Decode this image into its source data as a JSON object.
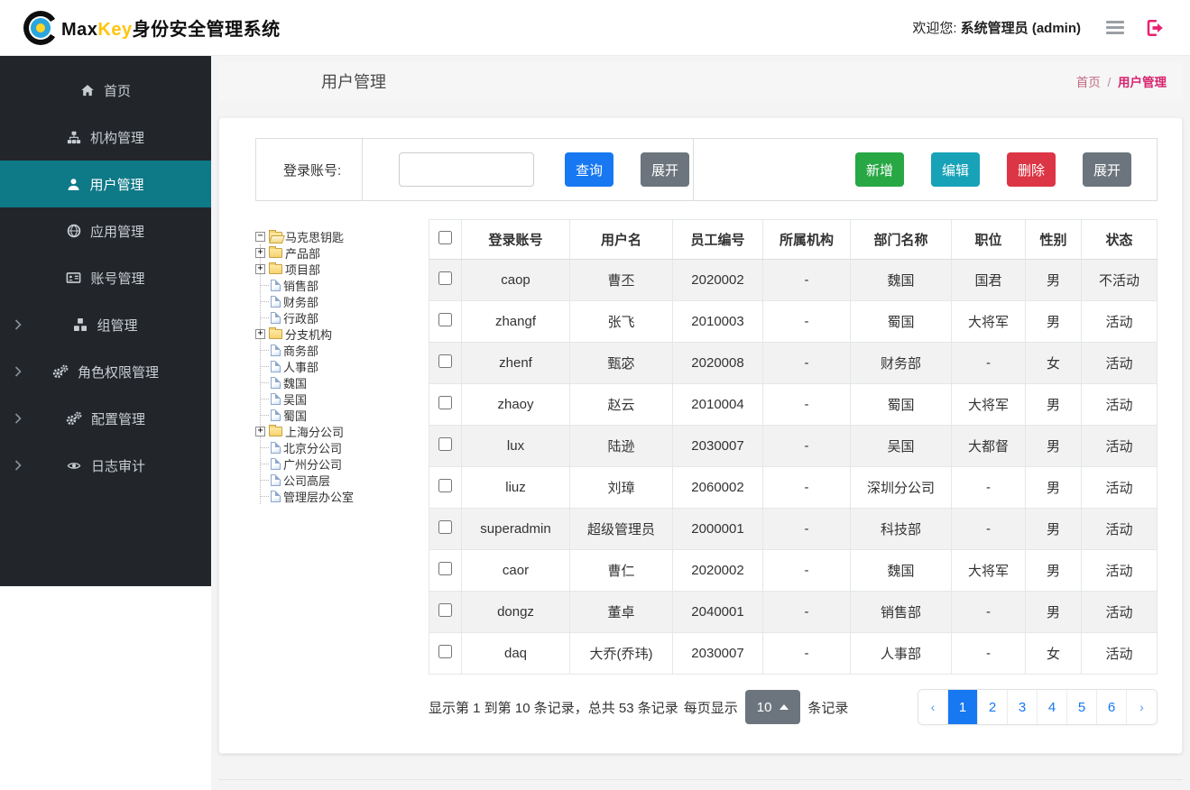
{
  "colors": {
    "accent_blue": "#1778f2",
    "green": "#28a745",
    "teal": "#17a2b8",
    "red": "#dc3545",
    "gray": "#6c757d",
    "sidebar_bg": "#22262b",
    "sidebar_active_teal": "#0e7987",
    "brand_yellow": "#ffc50a",
    "breadcrumb_pink": "#d6246e",
    "logout_pink": "#e8216f"
  },
  "header": {
    "brand_max": "Max",
    "brand_key": "Key",
    "brand_suffix": "身份安全管理系统",
    "welcome_prefix": "欢迎您:",
    "welcome_user": "系统管理员 (admin)",
    "icons": [
      "menu-icon",
      "logout-icon"
    ]
  },
  "sidebar": {
    "items": [
      {
        "key": "home",
        "label": "首页",
        "icon": "home-icon",
        "active": false,
        "has_children": false
      },
      {
        "key": "org-mgmt",
        "label": "机构管理",
        "icon": "sitemap-icon",
        "active": false,
        "has_children": false
      },
      {
        "key": "user-mgmt",
        "label": "用户管理",
        "icon": "user-icon",
        "active": true,
        "has_children": false
      },
      {
        "key": "app-mgmt",
        "label": "应用管理",
        "icon": "globe-icon",
        "active": false,
        "has_children": false
      },
      {
        "key": "account-mgmt",
        "label": "账号管理",
        "icon": "id-card-icon",
        "active": false,
        "has_children": false
      },
      {
        "key": "group-mgmt",
        "label": "组管理",
        "icon": "cubes-icon",
        "active": false,
        "has_children": true
      },
      {
        "key": "role-perm-mgmt",
        "label": "角色权限管理",
        "icon": "gears-icon",
        "active": false,
        "has_children": true
      },
      {
        "key": "config-mgmt",
        "label": "配置管理",
        "icon": "gears-icon",
        "active": false,
        "has_children": true
      },
      {
        "key": "log-audit",
        "label": "日志审计",
        "icon": "eye-icon",
        "active": false,
        "has_children": true
      }
    ]
  },
  "page": {
    "title": "用户管理",
    "breadcrumb": {
      "home": "首页",
      "separator": "/",
      "current": "用户管理"
    }
  },
  "search": {
    "label": "登录账号:",
    "input_value": "",
    "query_button": "查询",
    "expand_button": "展开"
  },
  "toolbar": {
    "add_button": "新增",
    "edit_button": "编辑",
    "delete_button": "删除",
    "expand_button": "展开"
  },
  "tree": {
    "nodes": [
      {
        "label": "马克思钥匙",
        "type": "folder-open",
        "expander": "minus",
        "level": 0
      },
      {
        "label": "产品部",
        "type": "folder",
        "expander": "plus",
        "level": 1
      },
      {
        "label": "项目部",
        "type": "folder",
        "expander": "plus",
        "level": 1
      },
      {
        "label": "销售部",
        "type": "file",
        "expander": "none",
        "level": 1
      },
      {
        "label": "财务部",
        "type": "file",
        "expander": "none",
        "level": 1
      },
      {
        "label": "行政部",
        "type": "file",
        "expander": "none",
        "level": 1
      },
      {
        "label": "分支机构",
        "type": "folder",
        "expander": "plus",
        "level": 1
      },
      {
        "label": "商务部",
        "type": "file",
        "expander": "none",
        "level": 1
      },
      {
        "label": "人事部",
        "type": "file",
        "expander": "none",
        "level": 1
      },
      {
        "label": "魏国",
        "type": "file",
        "expander": "none",
        "level": 1
      },
      {
        "label": "吴国",
        "type": "file",
        "expander": "none",
        "level": 1
      },
      {
        "label": "蜀国",
        "type": "file",
        "expander": "none",
        "level": 1
      },
      {
        "label": "上海分公司",
        "type": "folder",
        "expander": "plus",
        "level": 1
      },
      {
        "label": "北京分公司",
        "type": "file",
        "expander": "none",
        "level": 1
      },
      {
        "label": "广州分公司",
        "type": "file",
        "expander": "none",
        "level": 1
      },
      {
        "label": "公司高层",
        "type": "file",
        "expander": "none",
        "level": 1
      },
      {
        "label": "管理层办公室",
        "type": "file",
        "expander": "none",
        "level": 1
      }
    ]
  },
  "table": {
    "columns": [
      "登录账号",
      "用户名",
      "员工编号",
      "所属机构",
      "部门名称",
      "职位",
      "性别",
      "状态"
    ],
    "rows": [
      [
        "caop",
        "曹丕",
        "2020002",
        "-",
        "魏国",
        "国君",
        "男",
        "不活动"
      ],
      [
        "zhangf",
        "张飞",
        "2010003",
        "-",
        "蜀国",
        "大将军",
        "男",
        "活动"
      ],
      [
        "zhenf",
        "甄宓",
        "2020008",
        "-",
        "财务部",
        "-",
        "女",
        "活动"
      ],
      [
        "zhaoy",
        "赵云",
        "2010004",
        "-",
        "蜀国",
        "大将军",
        "男",
        "活动"
      ],
      [
        "lux",
        "陆逊",
        "2030007",
        "-",
        "吴国",
        "大都督",
        "男",
        "活动"
      ],
      [
        "liuz",
        "刘璋",
        "2060002",
        "-",
        "深圳分公司",
        "-",
        "男",
        "活动"
      ],
      [
        "superadmin",
        "超级管理员",
        "2000001",
        "-",
        "科技部",
        "-",
        "男",
        "活动"
      ],
      [
        "caor",
        "曹仁",
        "2020002",
        "-",
        "魏国",
        "大将军",
        "男",
        "活动"
      ],
      [
        "dongz",
        "董卓",
        "2040001",
        "-",
        "销售部",
        "-",
        "男",
        "活动"
      ],
      [
        "daq",
        "大乔(乔玮)",
        "2030007",
        "-",
        "人事部",
        "-",
        "女",
        "活动"
      ]
    ]
  },
  "pagination": {
    "summary": "显示第 1 到第 10 条记录，总共 53 条记录",
    "page_size_prefix": "每页显示",
    "page_size": "10",
    "page_size_suffix": "条记录",
    "prev": "‹",
    "next": "›",
    "pages": [
      "1",
      "2",
      "3",
      "4",
      "5",
      "6"
    ],
    "active_page": "1"
  }
}
